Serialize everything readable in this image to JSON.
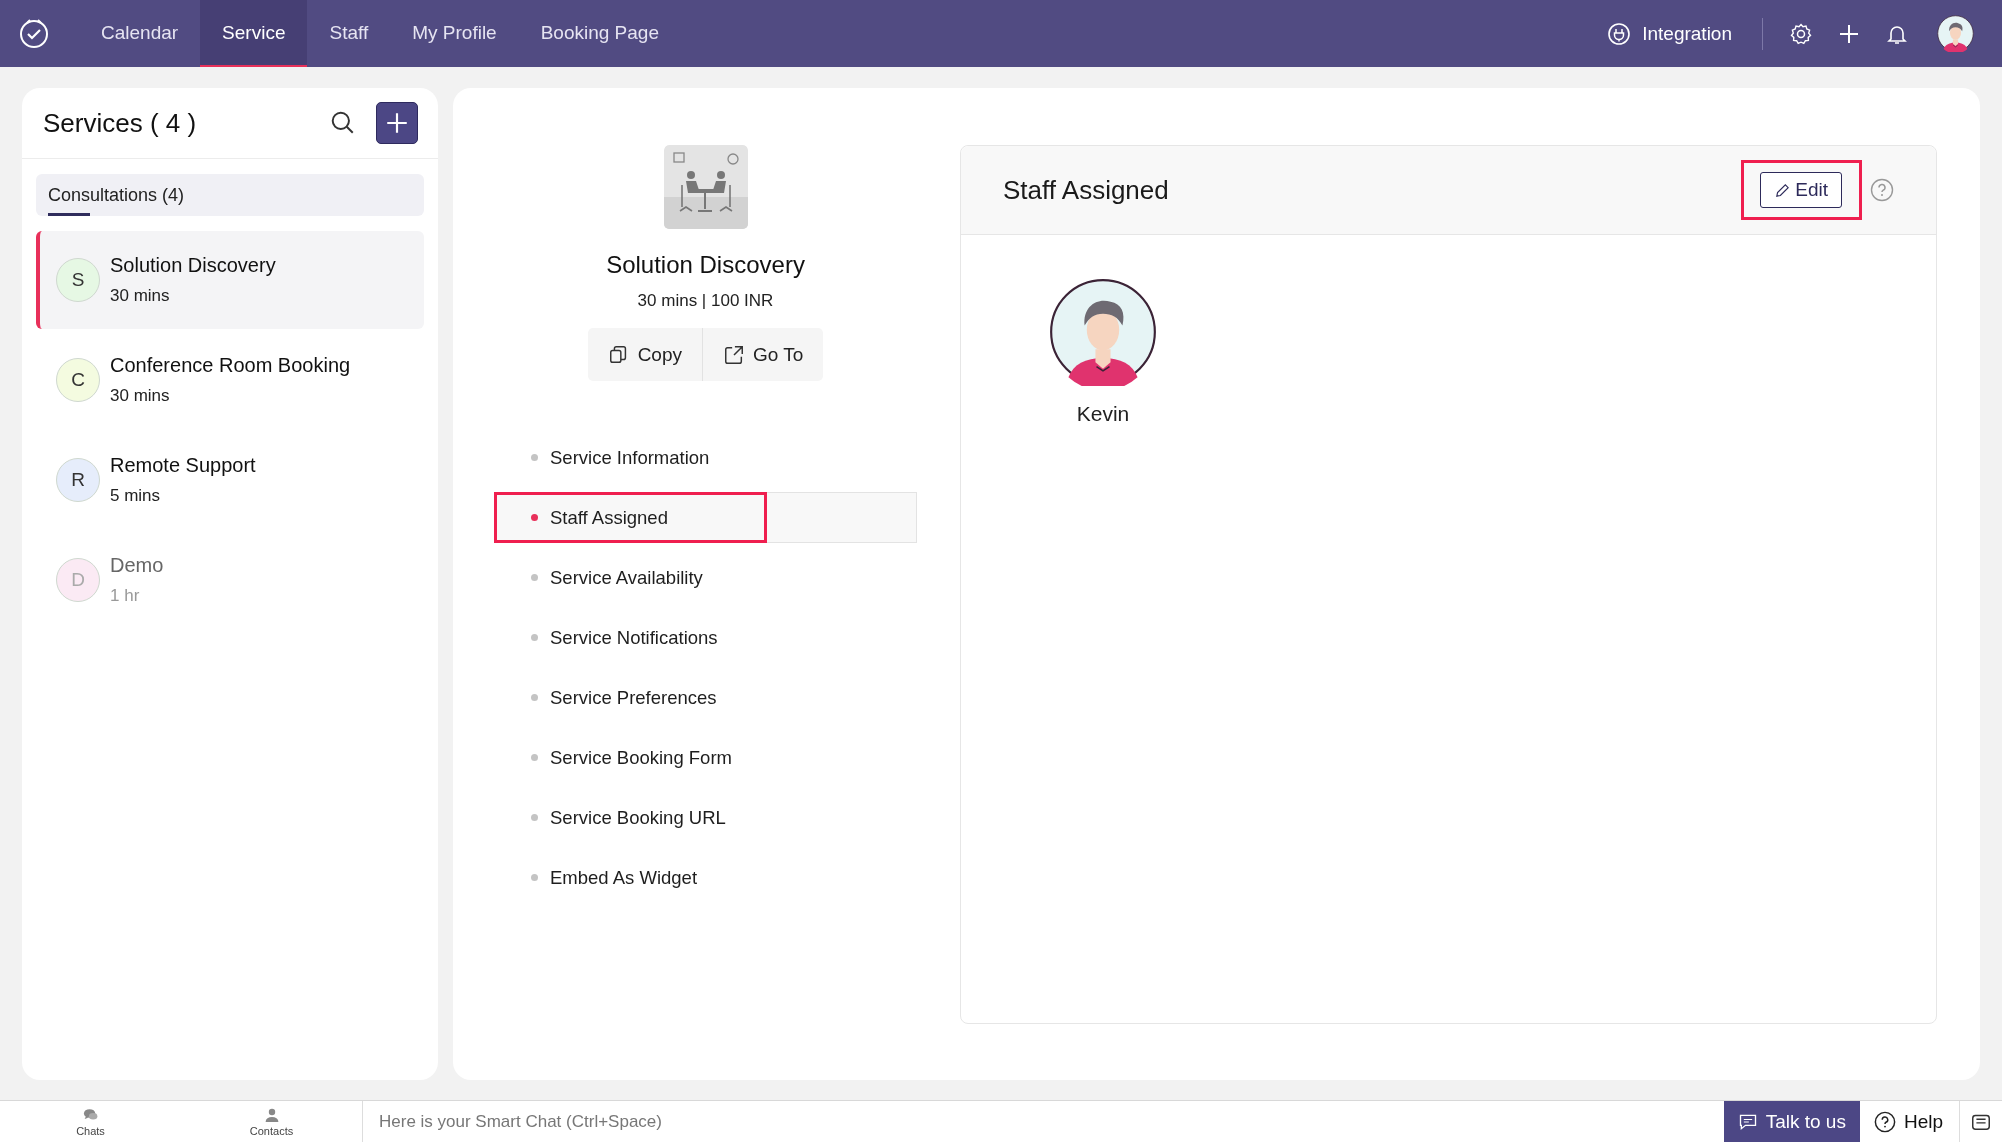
{
  "app_bar": {
    "nav": [
      {
        "label": "Calendar",
        "selected": false
      },
      {
        "label": "Service",
        "selected": true
      },
      {
        "label": "Staff",
        "selected": false
      },
      {
        "label": "My Profile",
        "selected": false
      },
      {
        "label": "Booking Page",
        "selected": false
      }
    ],
    "integration": "Integration"
  },
  "services_panel": {
    "title": "Services ( 4 )",
    "category_tab": {
      "label": "Consultations (4)",
      "selected": true
    },
    "services": [
      {
        "initial": "S",
        "name": "Solution Discovery",
        "duration": "30 mins",
        "selected": true,
        "disabled": false,
        "color": "#e6f8e4"
      },
      {
        "initial": "C",
        "name": "Conference Room Booking",
        "duration": "30 mins",
        "selected": false,
        "disabled": false,
        "color": "#f4fbe0"
      },
      {
        "initial": "R",
        "name": "Remote Support",
        "duration": "5 mins",
        "selected": false,
        "disabled": false,
        "color": "#e6edfb"
      },
      {
        "initial": "D",
        "name": "Demo",
        "duration": "1 hr",
        "selected": false,
        "disabled": true,
        "color": "#fbeaf4"
      }
    ]
  },
  "service_detail": {
    "name": "Solution Discovery",
    "summary": "30 mins | 100 INR",
    "actions": [
      {
        "label": "Copy",
        "kind": "copy"
      },
      {
        "label": "Go To",
        "kind": "goto"
      }
    ],
    "sections": [
      {
        "label": "Service Information",
        "selected": false,
        "highlighted": false
      },
      {
        "label": "Staff Assigned",
        "selected": true,
        "highlighted": true
      },
      {
        "label": "Service Availability",
        "selected": false,
        "highlighted": false
      },
      {
        "label": "Service Notifications",
        "selected": false,
        "highlighted": false
      },
      {
        "label": "Service Preferences",
        "selected": false,
        "highlighted": false
      },
      {
        "label": "Service Booking Form",
        "selected": false,
        "highlighted": false
      },
      {
        "label": "Service Booking URL",
        "selected": false,
        "highlighted": false
      },
      {
        "label": "Embed As Widget",
        "selected": false,
        "highlighted": false
      }
    ]
  },
  "staff_card": {
    "title": "Staff Assigned",
    "edit": {
      "label": "Edit",
      "highlighted": true
    },
    "staff": [
      {
        "name": "Kevin"
      }
    ]
  },
  "bottom_bar": {
    "apps": [
      {
        "label": "Chats",
        "kind": "chats"
      },
      {
        "label": "Contacts",
        "kind": "contacts"
      }
    ],
    "chat_placeholder": "Here is your Smart Chat (Ctrl+Space)",
    "talk": "Talk to us",
    "help": "Help"
  }
}
